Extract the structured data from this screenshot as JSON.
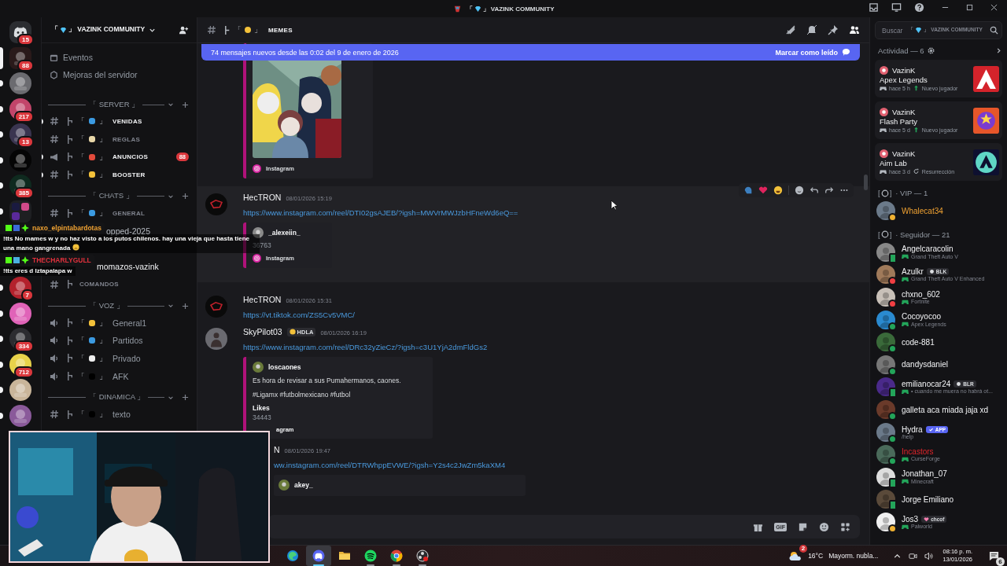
{
  "titlebar": {
    "open": "「",
    "close": "」",
    "title": "VAZINK COMMUNITY"
  },
  "servers": [
    {
      "kind": "home",
      "badge": "15",
      "selected": false,
      "unread": false
    },
    {
      "kind": "server",
      "badge": "88",
      "selected": true,
      "unread": false
    },
    {
      "kind": "server",
      "selected": false,
      "unread": true
    },
    {
      "kind": "server",
      "badge": "217",
      "selected": false,
      "unread": true
    },
    {
      "kind": "server",
      "badge": "13",
      "selected": false,
      "unread": true
    },
    {
      "kind": "server",
      "selected": false,
      "unread": true
    },
    {
      "kind": "server",
      "badge": "385",
      "selected": false,
      "unread": true
    },
    {
      "kind": "folder",
      "selected": false,
      "unread": true
    },
    {
      "kind": "server",
      "badge": "7",
      "selected": false,
      "unread": true
    },
    {
      "kind": "server",
      "selected": false,
      "unread": true
    },
    {
      "kind": "server",
      "badge": "334",
      "selected": false,
      "unread": true
    },
    {
      "kind": "server",
      "badge": "712",
      "selected": false,
      "unread": true
    },
    {
      "kind": "server",
      "selected": false,
      "unread": true
    },
    {
      "kind": "server",
      "selected": false,
      "unread": true
    }
  ],
  "sidebar": {
    "open": "「",
    "close": "」",
    "server_name": "VAZINK COMMUNITY",
    "links": [
      {
        "kind": "events",
        "label": "Eventos"
      },
      {
        "kind": "boosts",
        "label": "Mejoras del servidor"
      }
    ],
    "categories": [
      {
        "label": "「 SERVER 」",
        "channels": [
          {
            "kind": "text",
            "open": "「",
            "close": "」",
            "name": "VENIDAS",
            "unread": true,
            "covered": false
          },
          {
            "kind": "text",
            "open": "「",
            "close": "」",
            "name": "REGLAS",
            "unread": false,
            "covered": false
          },
          {
            "kind": "announce",
            "open": "「",
            "close": "」",
            "name": "ANUNCIOS",
            "unread": true,
            "covered": false,
            "badge": "88"
          },
          {
            "kind": "text",
            "open": "「",
            "close": "」",
            "name": "BOOSTER",
            "unread": true,
            "covered": false
          }
        ]
      },
      {
        "label": "「 CHATS 」",
        "channels": [
          {
            "kind": "text",
            "open": "「",
            "close": "」",
            "name": "GENERAL",
            "unread": false,
            "covered": false
          },
          {
            "kind": "thread",
            "name": "opped-2025",
            "unread": false,
            "covered": true
          },
          {
            "kind": "thread",
            "name": "momazos-vazink",
            "unread": true,
            "covered": false
          },
          {
            "kind": "text",
            "name": "COMANDOS",
            "unread": false,
            "covered": false
          }
        ]
      },
      {
        "label": "「 VOZ 」",
        "channels": [
          {
            "kind": "voice",
            "open": "「",
            "close": "」",
            "name": "General1",
            "unread": false,
            "covered": false
          },
          {
            "kind": "voice",
            "open": "「",
            "close": "」",
            "name": "Partidos",
            "unread": false,
            "covered": false
          },
          {
            "kind": "voice",
            "open": "「",
            "close": "」",
            "name": "Privado",
            "unread": false,
            "covered": false
          },
          {
            "kind": "voice",
            "open": "「",
            "close": "」",
            "name": "AFK",
            "unread": false,
            "covered": false
          }
        ]
      },
      {
        "label": "「 DINAMICA 」",
        "channels": [
          {
            "kind": "text",
            "open": "「",
            "close": "」",
            "name": "texto",
            "unread": false,
            "covered": false
          }
        ]
      }
    ]
  },
  "chat": {
    "open": "「",
    "close": "」",
    "channel": "MEMES",
    "banner": {
      "text": "74 mensajes nuevos desde las 0:02 del 9 de enero de 2026",
      "action": "Marcar como leído"
    },
    "messages": [
      {
        "kind": "continued",
        "hovered": false,
        "embed": {
          "footer": "Instagram",
          "footer_cut": false
        }
      },
      {
        "kind": "message",
        "author": "HecTRON",
        "time": "08/01/2026 15:19",
        "link": "https://www.instagram.com/reel/DTI02gsAJEB/?igsh=MWVrMWJzbHFneWd6eQ==",
        "hovered": true,
        "embed": {
          "author": "_alexeiin_",
          "fields": [
            {
              "value": "36763"
            }
          ],
          "footer": "Instagram",
          "footer_cut": false
        }
      },
      {
        "kind": "message",
        "author": "HecTRON",
        "time": "08/01/2026 15:31",
        "link": "https://vt.tiktok.com/ZS5Cv5VMC/",
        "hovered": false
      },
      {
        "kind": "message",
        "author": "SkyPilot03",
        "tag": "HDLA",
        "time": "08/01/2026 16:19",
        "link": "https://www.instagram.com/reel/DRc32yZieCz/?igsh=c3U1YjA2dmFldGs2",
        "hovered": false,
        "embed": {
          "author": "loscaones",
          "description": [
            "Es hora de revisar a sus Pumahermanos, caones.",
            "#Ligamx #futbolmexicano #futbol"
          ],
          "fields": [
            {
              "name": "Likes",
              "value": "34443"
            }
          ],
          "footer": "agram",
          "footer_cut": true
        }
      },
      {
        "kind": "clipped",
        "author": "N",
        "time": "08/01/2026 19:47",
        "link": "ww.instagram.com/reel/DTRWhppEVWE/?igsh=Y2s4c2JwZm5kaXM4",
        "hovered": false,
        "embed": {
          "author": "akey_"
        }
      }
    ],
    "composer": {
      "gif": "GIF"
    }
  },
  "search": {
    "placeholder": "Buscar",
    "open": "「",
    "close": "」",
    "scope": "VAZINK COMMUNITY"
  },
  "activity": {
    "title": "Actividad — 6",
    "cards": [
      {
        "user": "VazinK",
        "game": "Apex Legends",
        "time": "hace 5 h",
        "tag": {
          "text": "Nuevo jugador",
          "kind": "new"
        }
      },
      {
        "user": "VazinK",
        "game": "Flash Party",
        "time": "hace 5 d",
        "tag": {
          "text": "Nuevo jugador",
          "kind": "new"
        }
      },
      {
        "user": "VazinK",
        "game": "Aim Lab",
        "time": "hace 3 d",
        "tag": {
          "text": "Resurrección",
          "kind": "revive"
        }
      }
    ]
  },
  "member_groups": [
    {
      "open": "[",
      "close": "]",
      "label": "· VIP — 1",
      "members": [
        {
          "name": "Whalecat34",
          "kind": "vip",
          "color": "#f0b232",
          "mobile": false
        }
      ]
    },
    {
      "open": "[",
      "close": "]",
      "label": "· Seguidor — 21",
      "members": [
        {
          "name": "Angelcaracolin",
          "kind": "plain",
          "color": "#23a55a",
          "mobile": true,
          "activity": {
            "text": "Grand Theft Auto V",
            "kind": "game"
          }
        },
        {
          "name": "Azulkr",
          "kind": "plain",
          "color": "#f23f43",
          "mobile": false,
          "badge": {
            "text": "BLK",
            "kind": "tag"
          },
          "activity": {
            "text": "Grand Theft Auto V Enhanced",
            "kind": "game"
          }
        },
        {
          "name": "chxno_602",
          "kind": "plain",
          "color": "#f23f43",
          "mobile": false,
          "activity": {
            "text": "Fortnite",
            "kind": "game"
          }
        },
        {
          "name": "Cocoyocoo",
          "kind": "plain",
          "color": "#23a55a",
          "mobile": false,
          "activity": {
            "text": "Apex Legends",
            "kind": "game"
          }
        },
        {
          "name": "code-881",
          "kind": "plain",
          "color": "#23a55a",
          "mobile": false
        },
        {
          "name": "dandysdaniel",
          "kind": "plain",
          "color": "#23a55a",
          "mobile": false
        },
        {
          "name": "emilianocar24",
          "kind": "plain",
          "color": "#23a55a",
          "mobile": true,
          "badge": {
            "text": "BLR",
            "kind": "tag"
          },
          "activity": {
            "text": "• cuando me muera no habrá ot...",
            "kind": "game"
          }
        },
        {
          "name": "galleta aca miada jaja xd",
          "kind": "plain",
          "color": "#23a55a",
          "mobile": false
        },
        {
          "name": "Hydra",
          "kind": "plain",
          "color": "#23a55a",
          "mobile": false,
          "badge": {
            "text": "APP",
            "kind": "app"
          },
          "activity": {
            "text": "/help",
            "kind": "custom"
          }
        },
        {
          "name": "Incastors",
          "kind": "alert",
          "color": "#23a55a",
          "mobile": false,
          "activity": {
            "text": "CurseForge",
            "kind": "game"
          }
        },
        {
          "name": "Jonathan_07",
          "kind": "plain",
          "color": "#23a55a",
          "mobile": true,
          "activity": {
            "text": "Minecraft",
            "kind": "game"
          }
        },
        {
          "name": "Jorge Emiliano",
          "kind": "plain",
          "color": "#23a55a",
          "mobile": true
        },
        {
          "name": "Jos3",
          "kind": "plain",
          "color": "#f0b232",
          "mobile": false,
          "badge": {
            "text": "chcof",
            "kind": "heart"
          },
          "activity": {
            "text": "Palworld",
            "kind": "game"
          }
        }
      ]
    }
  ],
  "stream_chat": [
    {
      "user": "naxo_elpintabardotas",
      "color": "#f0a232",
      "text": "!tts No mames w y no haz visto a los putos chilenos. hay una vieja que hasta tiene una mano gangrenada",
      "emoji": true
    },
    {
      "user": "THECHARLYGULL",
      "color": "#e0313c",
      "text": "!tts eres d Iztapalapa w",
      "emoji": false
    }
  ],
  "taskbar": {
    "apps": [
      {
        "kind": "edge",
        "running": false,
        "selected": false
      },
      {
        "kind": "discord",
        "running": true,
        "selected": true
      },
      {
        "kind": "folder",
        "running": false,
        "selected": false
      },
      {
        "kind": "spotify",
        "running": true,
        "selected": false
      },
      {
        "kind": "chrome",
        "running": true,
        "selected": false
      },
      {
        "kind": "obs",
        "running": true,
        "selected": false
      }
    ],
    "weather": {
      "temp": "16°C",
      "text": "Mayorm. nubla...",
      "badge": "2"
    },
    "clock": {
      "time": "08:16 p. m.",
      "date": "13/01/2026"
    },
    "notifications": "6"
  }
}
